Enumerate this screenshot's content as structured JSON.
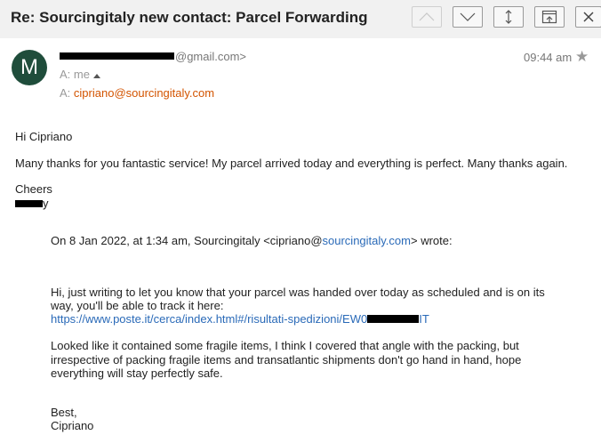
{
  "header": {
    "subject": "Re: Sourcingitaly new contact: Parcel Forwarding",
    "buttons": [
      "previous",
      "next",
      "more",
      "open-in-new-window",
      "close"
    ]
  },
  "sender": {
    "avatar_letter": "M",
    "avatar_color": "#1f4d3b",
    "email_suffix": "@gmail.com>",
    "to_label": "A:",
    "to_value": "me",
    "cc_label": "A:",
    "cc_value": "cipriano@sourcingitaly.com",
    "time": "09:44 am"
  },
  "message": {
    "greeting": "Hi Cipriano",
    "line1": "Many thanks for you fantastic service!  My parcel arrived today and everything is perfect. Many thanks again.",
    "signoff": "Cheers",
    "signature_suffix": "y"
  },
  "quoted": {
    "attribution_prefix": "On 8 Jan 2022, at 1:34 am, Sourcingitaly <cipriano@",
    "attribution_link": "sourcingitaly.com",
    "attribution_suffix": "> wrote:",
    "para1_line1": "Hi, just writing to let you know that your parcel was handed over today as scheduled and is on its",
    "para1_line2": "way, you'll be able to track it here:",
    "tracking_link_prefix": "https://www.poste.it/cerca/index.html#/risultati-spedizioni/EW0",
    "tracking_link_suffix": "IT",
    "para2_line1": "Looked like it contained some fragile items, I think I covered that angle with the packing, but",
    "para2_line2": "irrespective of packing fragile items and transatlantic shipments don't go hand in hand, hope",
    "para2_line3": "everything will stay perfectly safe.",
    "closing": "Best,",
    "closing_name": "Cipriano"
  },
  "colors": {
    "header_bg": "#f1f1f1",
    "link": "#2a6ab8",
    "cc_address": "#d35400"
  }
}
